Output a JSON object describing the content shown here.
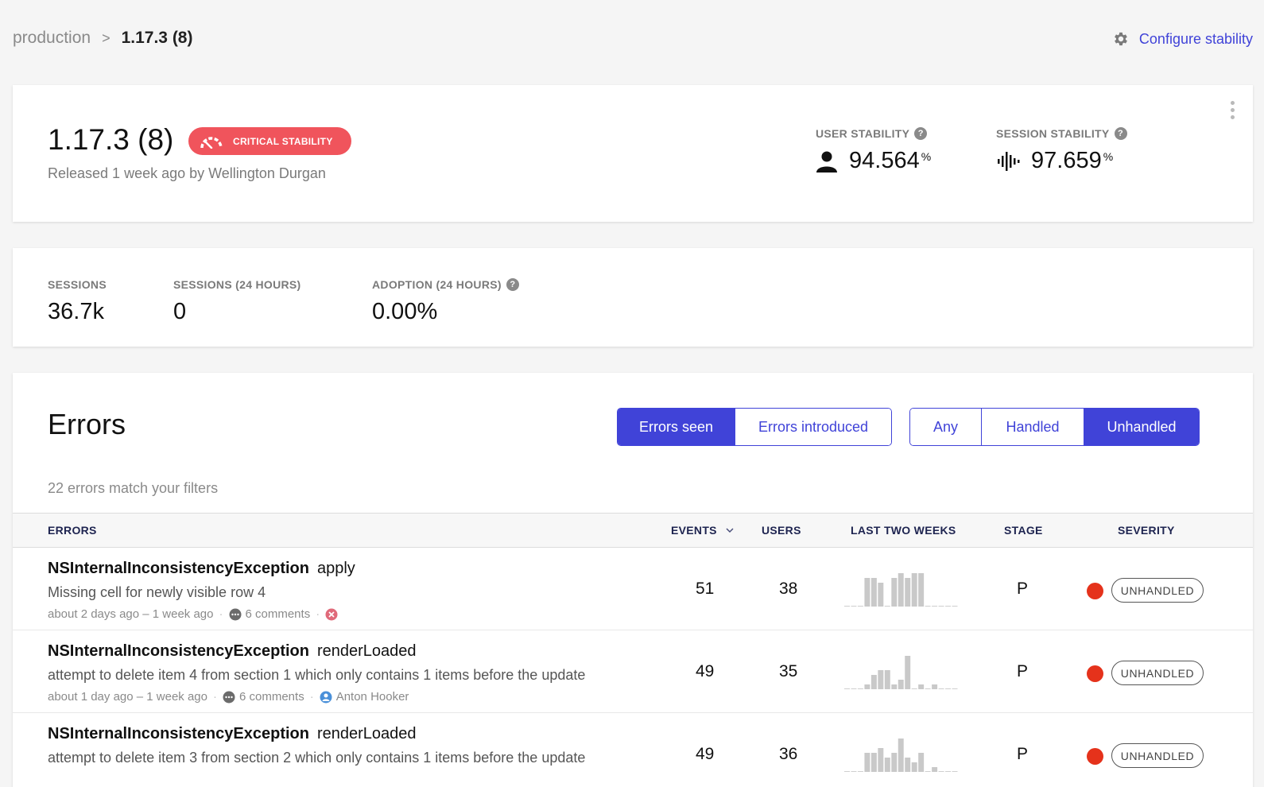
{
  "breadcrumb": {
    "parent": "production",
    "separator": ">",
    "current": "1.17.3 (8)"
  },
  "configure": {
    "label": "Configure stability",
    "icon": "gear-icon"
  },
  "release": {
    "title": "1.17.3 (8)",
    "badge": "CRITICAL STABILITY",
    "released": "Released 1 week ago by Wellington Durgan",
    "user_stability": {
      "label": "USER STABILITY",
      "value": "94.564",
      "unit": "%"
    },
    "session_stability": {
      "label": "SESSION STABILITY",
      "value": "97.659",
      "unit": "%"
    }
  },
  "metrics": [
    {
      "label": "SESSIONS",
      "value": "36.7k"
    },
    {
      "label": "SESSIONS (24 HOURS)",
      "value": "0"
    },
    {
      "label": "ADOPTION (24 HOURS)",
      "value": "0.00%"
    }
  ],
  "errors": {
    "title": "Errors",
    "seg_scope": [
      "Errors seen",
      "Errors introduced"
    ],
    "seg_handled": [
      "Any",
      "Handled",
      "Unhandled"
    ],
    "match_text": "22 errors match your filters",
    "columns": {
      "errors": "ERRORS",
      "events": "EVENTS",
      "users": "USERS",
      "trend": "LAST TWO WEEKS",
      "stage": "STAGE",
      "severity": "SEVERITY"
    },
    "rows": [
      {
        "class": "NSInternalInconsistencyException",
        "context": "apply",
        "message": "Missing cell for newly visible row 4",
        "time": "about 2 days ago – 1 week ago",
        "comments": "6 comments",
        "assignee": "",
        "events": "51",
        "users": "38",
        "stage": "P",
        "severity": "UNHANDLED",
        "trend": [
          0,
          0,
          0,
          6,
          6,
          5,
          0,
          6,
          7,
          6,
          7,
          7,
          0,
          0,
          0,
          0,
          0
        ]
      },
      {
        "class": "NSInternalInconsistencyException",
        "context": "renderLoaded",
        "message": "attempt to delete item 4 from section 1 which only contains 1 items before the update",
        "time": "about 1 day ago – 1 week ago",
        "comments": "6 comments",
        "assignee": "Anton Hooker",
        "events": "49",
        "users": "35",
        "stage": "P",
        "severity": "UNHANDLED",
        "trend": [
          0,
          0,
          0,
          1,
          3,
          4,
          4,
          1,
          2,
          7,
          0,
          1,
          0,
          1,
          0,
          0,
          0
        ]
      },
      {
        "class": "NSInternalInconsistencyException",
        "context": "renderLoaded",
        "message": "attempt to delete item 3 from section 2 which only contains 1 items before the update",
        "time": "",
        "comments": "",
        "assignee": "",
        "events": "49",
        "users": "36",
        "stage": "P",
        "severity": "UNHANDLED",
        "trend": [
          0,
          0,
          0,
          4,
          4,
          5,
          3,
          4,
          7,
          3,
          2,
          4,
          0,
          1,
          0,
          0,
          0
        ]
      }
    ]
  },
  "colors": {
    "accent": "#4043d8",
    "critical": "#f0545c",
    "severity_dot": "#e5321b",
    "bar": "#c9c9c9"
  }
}
